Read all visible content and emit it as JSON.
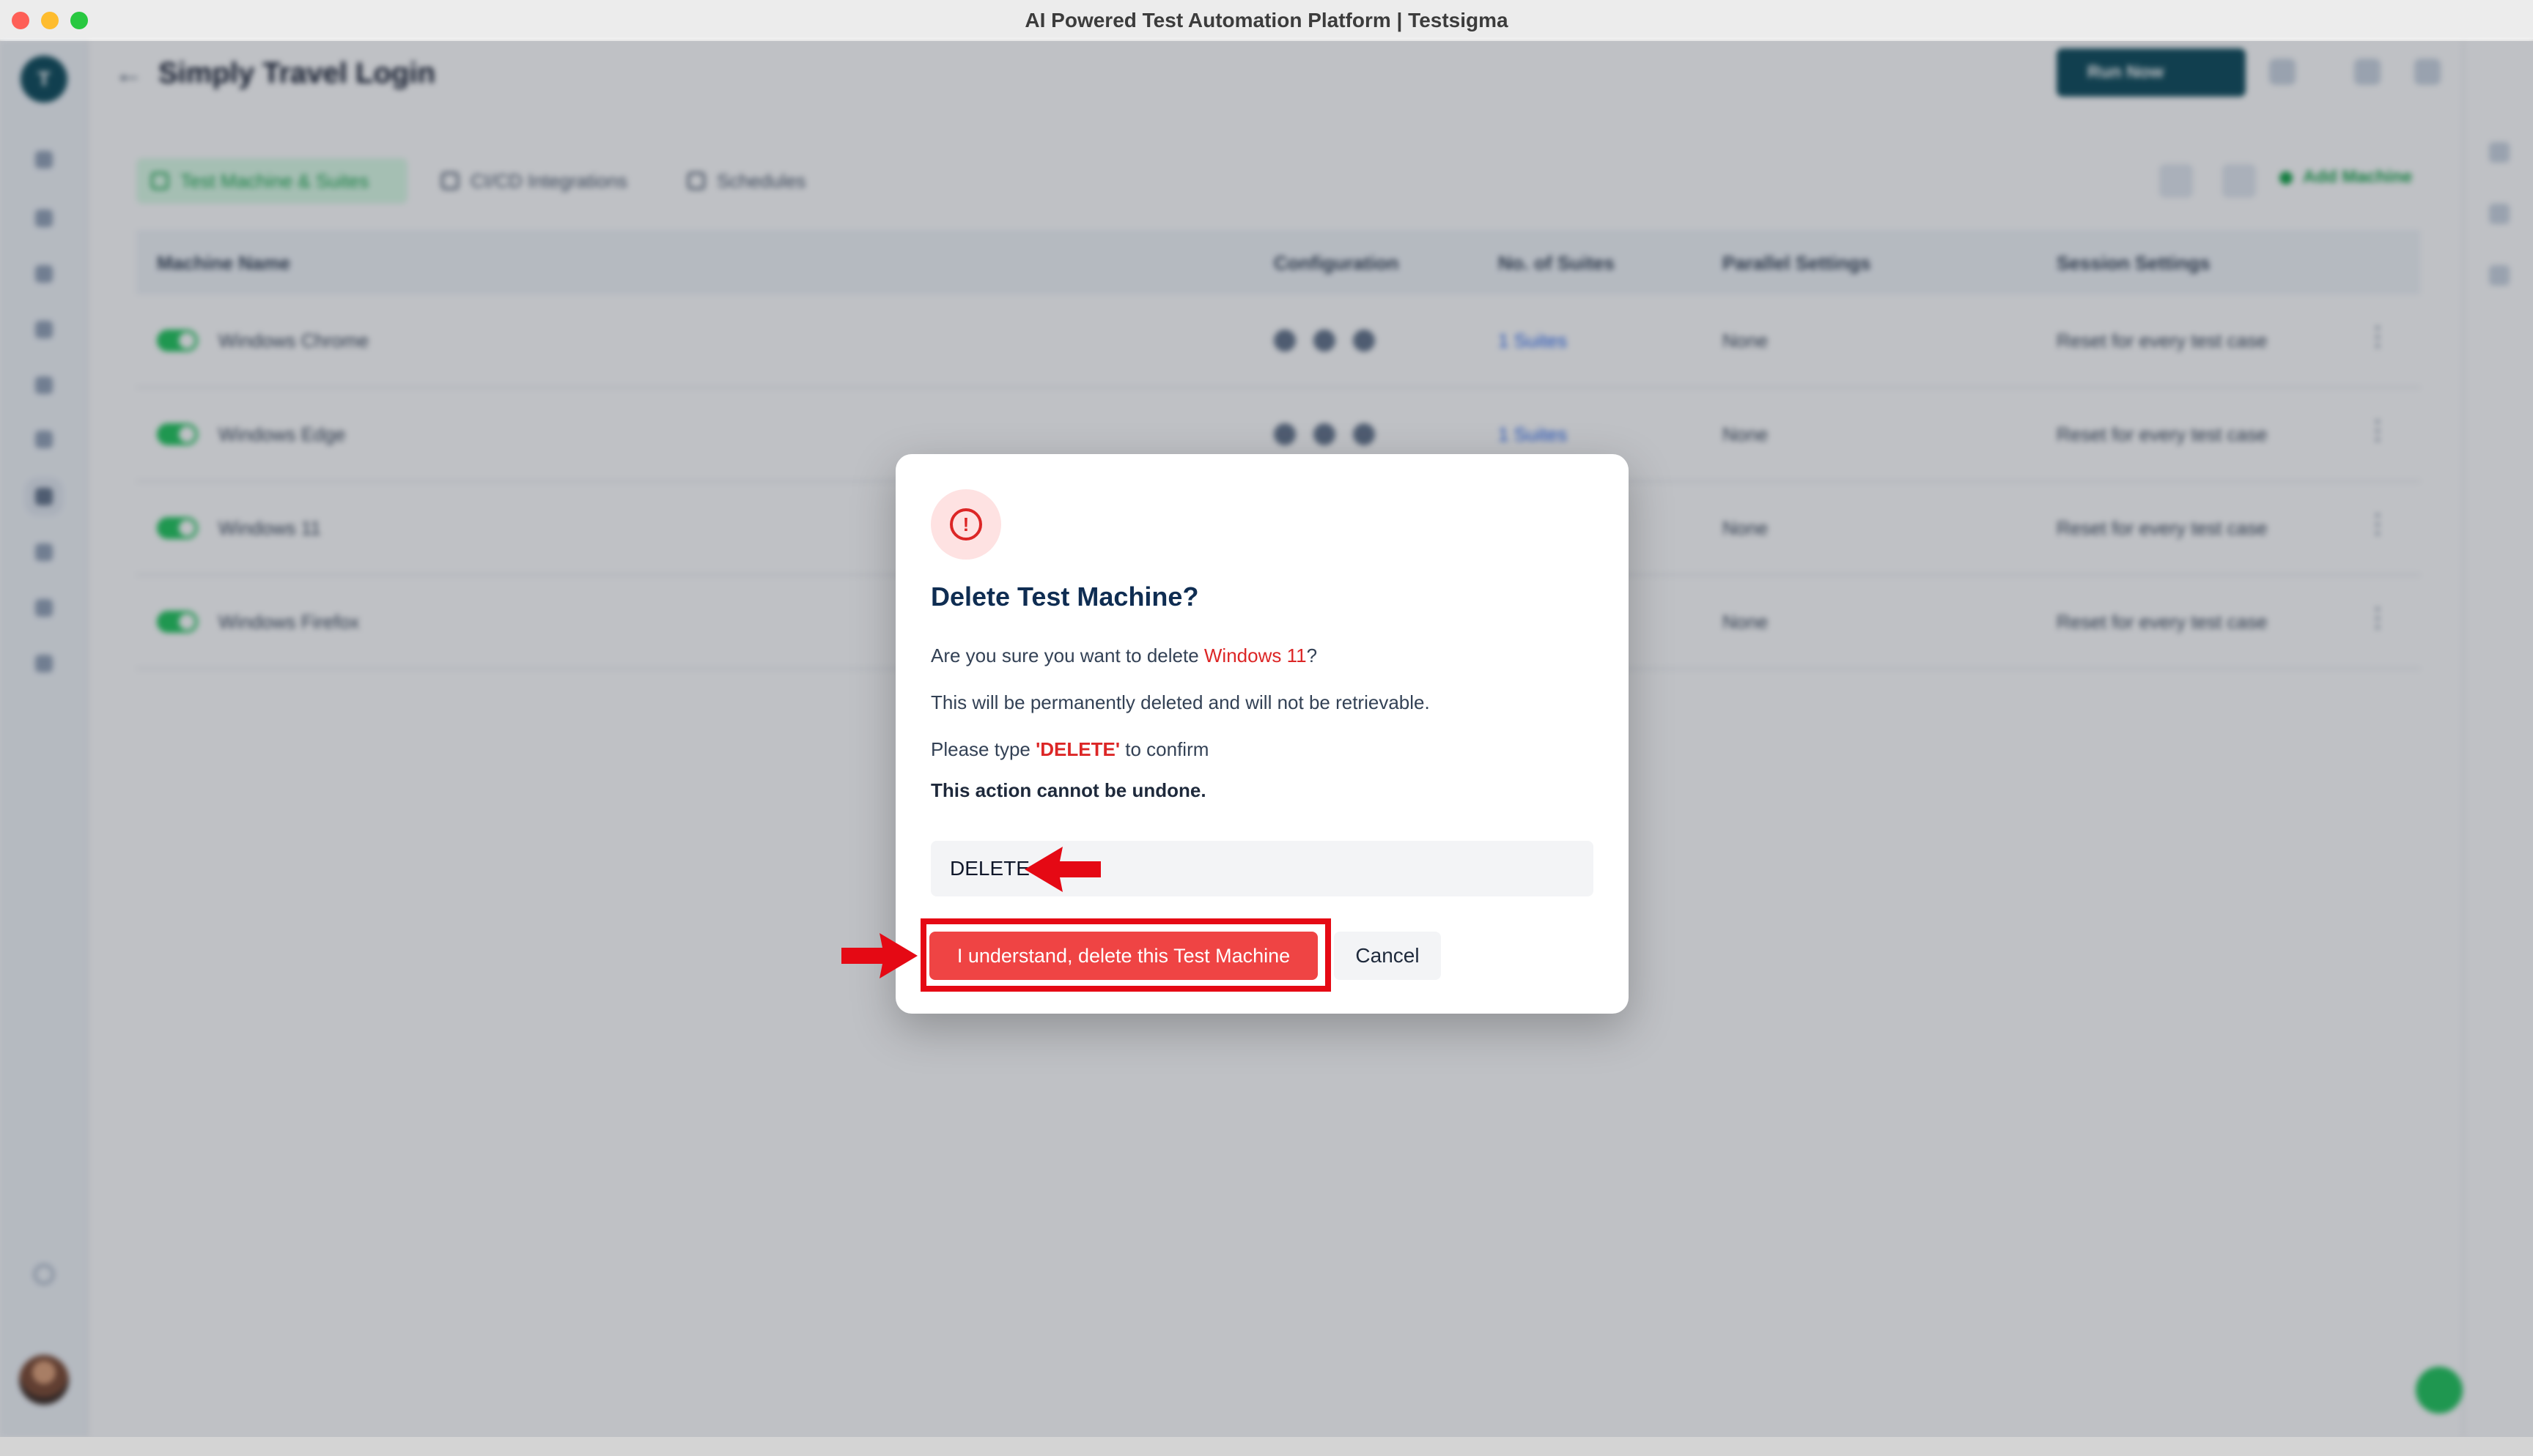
{
  "window": {
    "title": "AI Powered Test Automation Platform | Testsigma"
  },
  "app": {
    "logo_letter": "T",
    "project_title": "Simply Travel Login",
    "run_button_label": "Run Now",
    "subtabs": [
      "Test Machine & Suites",
      "CI/CD Integrations",
      "Schedules"
    ],
    "add_machine_label": "Add Machine",
    "table": {
      "columns": [
        "Machine Name",
        "Configuration",
        "No. of Suites",
        "Parallel Settings",
        "Session Settings"
      ],
      "rows": [
        {
          "name": "Windows Chrome",
          "suites": "1 Suites",
          "parallel": "None",
          "session": "Reset for every test case"
        },
        {
          "name": "Windows Edge",
          "suites": "1 Suites",
          "parallel": "None",
          "session": "Reset for every test case"
        },
        {
          "name": "Windows 11",
          "suites": "",
          "parallel": "None",
          "session": "Reset for every test case"
        },
        {
          "name": "Windows Firefox",
          "suites": "",
          "parallel": "None",
          "session": "Reset for every test case"
        }
      ]
    }
  },
  "dialog": {
    "title": "Delete Test Machine?",
    "question_prefix": "Are you sure you want to delete ",
    "machine_name": "Windows 11",
    "question_suffix": "?",
    "permanent_note": "This will be permanently deleted and will not be retrievable.",
    "type_prefix": "Please type ",
    "type_keyword": "'DELETE'",
    "type_suffix": " to confirm",
    "undone_warning": "This action cannot be undone.",
    "input_value": "DELETE",
    "delete_button_label": "I understand, delete this Test Machine",
    "cancel_button_label": "Cancel"
  },
  "colors": {
    "accent_red": "#ef4444",
    "annotation_red": "#e50914",
    "brand_dark": "#0f4c5c",
    "success_green": "#22c55e"
  },
  "icons": {
    "dialog_icon": "alert-circle-icon",
    "annotation": "red-arrow-icon"
  }
}
